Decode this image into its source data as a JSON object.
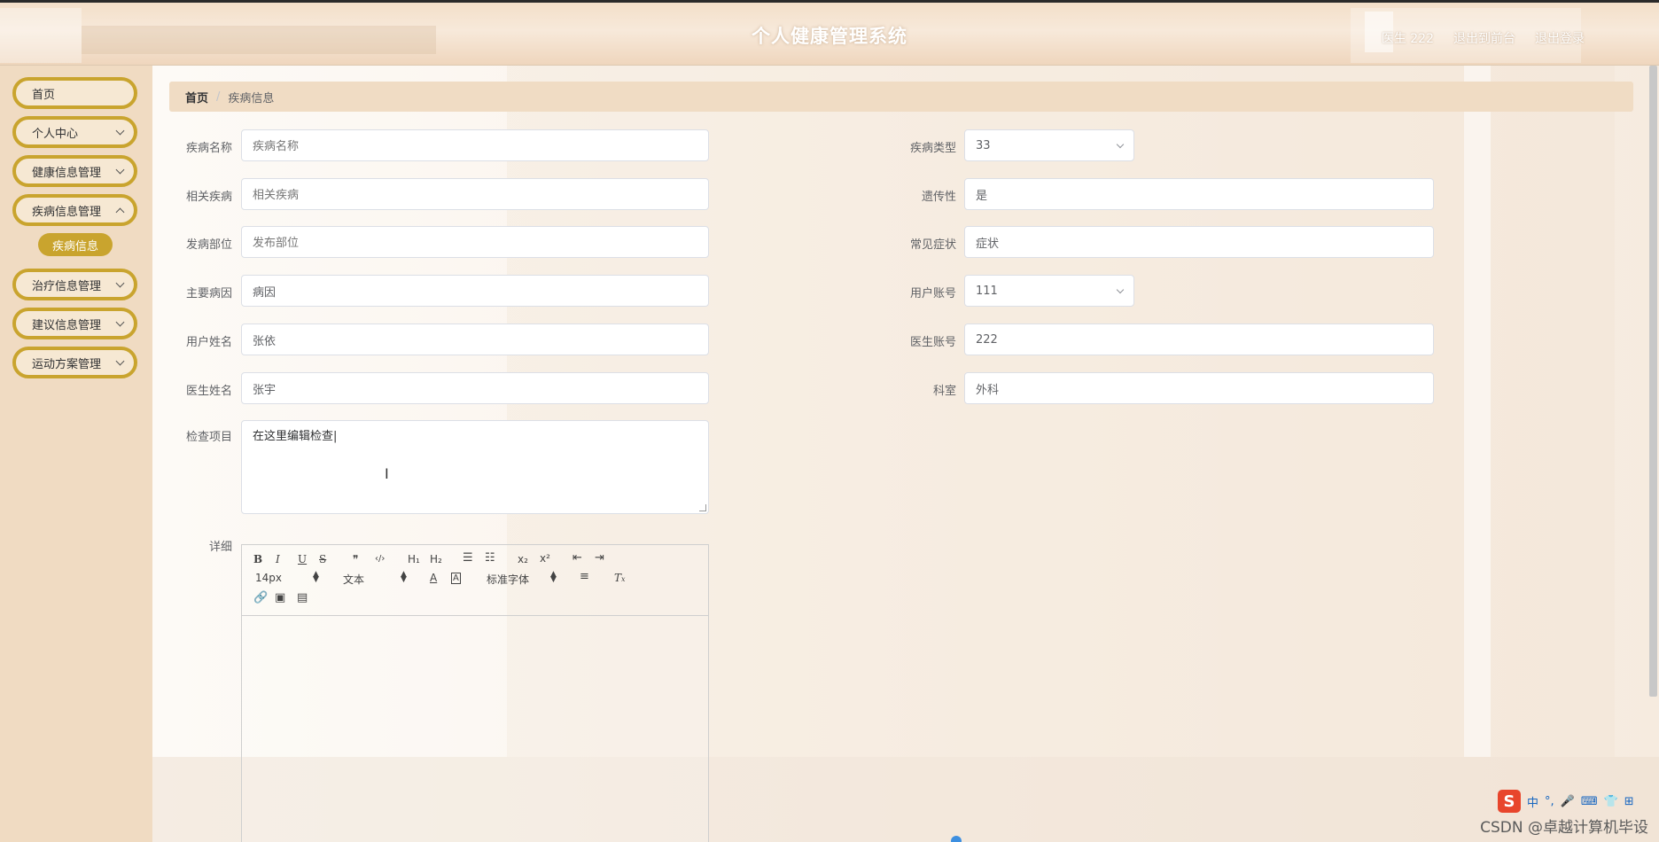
{
  "header": {
    "title": "个人健康管理系统",
    "user_label": "医生 222",
    "front_link": "退出到前台",
    "logout_link": "退出登录"
  },
  "sidebar": {
    "items": [
      {
        "label": "首页"
      },
      {
        "label": "个人中心"
      },
      {
        "label": "健康信息管理"
      },
      {
        "label": "疾病信息管理"
      },
      {
        "label": "治疗信息管理"
      },
      {
        "label": "建议信息管理"
      },
      {
        "label": "运动方案管理"
      }
    ],
    "active_sub": "疾病信息"
  },
  "breadcrumb": {
    "home": "首页",
    "separator": "/",
    "current": "疾病信息"
  },
  "form": {
    "disease_name": {
      "label": "疾病名称",
      "placeholder": "疾病名称"
    },
    "disease_type": {
      "label": "疾病类型",
      "value": "33"
    },
    "related_disease": {
      "label": "相关疾病",
      "placeholder": "相关疾病"
    },
    "hereditary": {
      "label": "遗传性",
      "value": "是"
    },
    "onset_site": {
      "label": "发病部位",
      "placeholder": "发布部位"
    },
    "common_symptoms": {
      "label": "常见症状",
      "value": "症状"
    },
    "main_cause": {
      "label": "主要病因",
      "value": "病因"
    },
    "user_account": {
      "label": "用户账号",
      "value": "111"
    },
    "user_name": {
      "label": "用户姓名",
      "value": "张依"
    },
    "doctor_account": {
      "label": "医生账号",
      "value": "222"
    },
    "doctor_name": {
      "label": "医生姓名",
      "value": "张宇"
    },
    "department": {
      "label": "科室",
      "value": "外科"
    },
    "exam_items": {
      "label": "检查项目",
      "value": "在这里编辑检查|"
    },
    "details": {
      "label": "详细"
    }
  },
  "editor": {
    "toolbar": {
      "bold": "B",
      "italic": "I",
      "underline": "U",
      "strike": "S",
      "quote": "❞",
      "code": "‹/›",
      "h1": "H₁",
      "h2": "H₂",
      "subscript": "x₂",
      "superscript": "x²",
      "font_size": "14px",
      "text_style": "文本",
      "font_family": "标准字体"
    }
  },
  "ime": {
    "lang": "中"
  },
  "watermark": "CSDN @卓越计算机毕设"
}
